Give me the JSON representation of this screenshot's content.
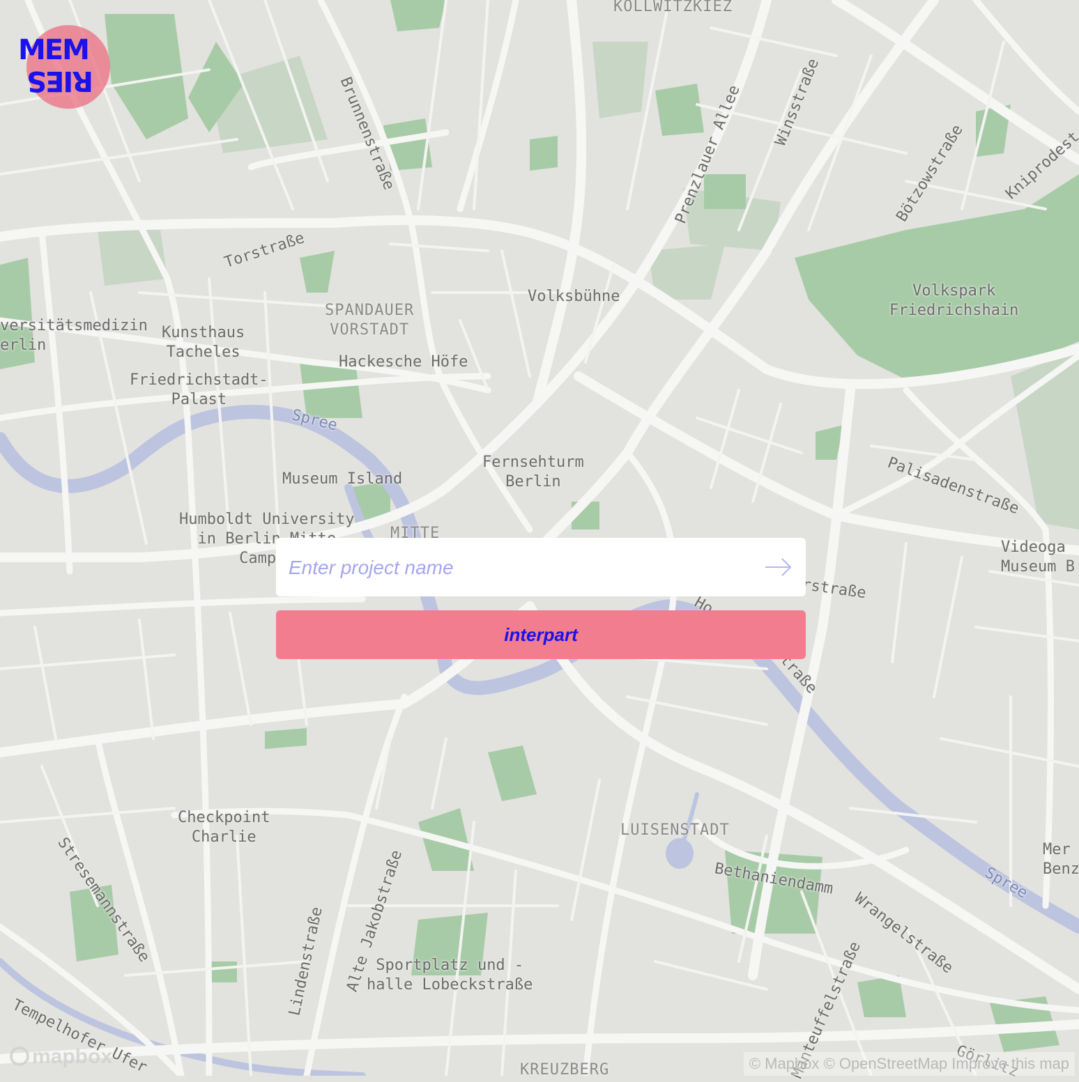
{
  "logo": {
    "top_text": "MEM",
    "bottom_text": "RIES",
    "aria": "MEMRIES"
  },
  "project_form": {
    "input_placeholder": "Enter project name",
    "input_value": "",
    "submit_icon": "arrow-right-icon",
    "join_button_label": "interpart"
  },
  "attribution": {
    "text": "© Mapbox © OpenStreetMap Improve this map"
  },
  "mapbox_logo": {
    "text": "mapbox"
  },
  "map_labels": {
    "kollwitzkiez": "KOLLWITZKIEZ",
    "brunnenstrasse": "Brunnenstraße",
    "prenzlauer_allee": "Prenzlauer Allee",
    "winsstrasse": "Winsstraße",
    "boetzowstrasse": "Bötzowstraße",
    "kniprodestr": "Kniprodest",
    "torstrasse": "Torstraße",
    "volksbuehne": "Volksbühne",
    "volkspark": "Volkspark\nFriedrichshain",
    "spandauer_vorstadt": "SPANDAUER\nVORSTADT",
    "universitaetsmedizin": "versitätsmedizin\nerlin",
    "kunsthaus": "Kunsthaus\nTacheles",
    "hackesche_hoefe": "Hackesche Höfe",
    "friedrichstadt_palast": "Friedrichstadt-\nPalast",
    "spree_1": "Spree",
    "fernsehturm": "Fernsehturm\nBerlin",
    "palisadenstrasse": "Palisadenstraße",
    "museum_island": "Museum Island",
    "humboldt": "Humboldt University\nin Berlin Mitte\nCampus",
    "mitte": "MITTE",
    "videogame_museum": "Videoga\nMuseum B",
    "torstrasse_2": "rstraße",
    "holzmarkt": "Ho",
    "strasse_frag": "traße",
    "checkpoint": "Checkpoint\nCharlie",
    "luisenstadt": "LUISENSTADT",
    "bethaniendamm": "Bethaniendamm",
    "mer_benz": "Mer\nBenz",
    "spree_2": "Spree",
    "stresemannstrasse": "Stresemannstraße",
    "alte_jakobstrasse": "Alte Jakobstraße",
    "lindenstrasse": "Lindenstraße",
    "sportplatz": "Sportplatz und -\nhalle Lobeckstraße",
    "wrangelstrasse": "Wrangelstraße",
    "manteuffelstrasse": "Manteuffelstraße",
    "tempelhofer_ufer": "Tempelhofer Ufer",
    "kreuzberg": "KREUZBERG",
    "goerlitzer": "Görlitz"
  },
  "colors": {
    "land": "#e2e2de",
    "road": "#f6f6f4",
    "park": "#a8cba7",
    "water": "#bcc4e0",
    "accent_blue": "#1a12e8",
    "accent_pink": "#f27d8f"
  }
}
